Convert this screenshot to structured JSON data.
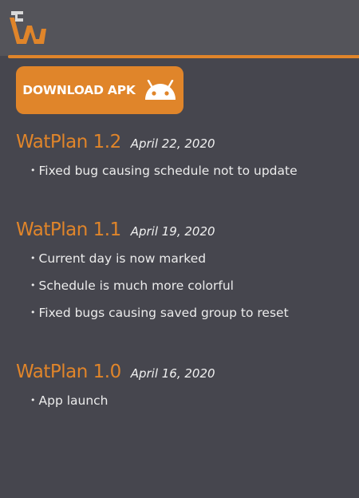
{
  "download_button": {
    "label": "DOWNLOAD APK",
    "icon": "android-icon"
  },
  "releases": [
    {
      "version": "WatPlan 1.2",
      "date": "April 22, 2020",
      "notes": [
        "Fixed bug causing schedule not to update"
      ]
    },
    {
      "version": "WatPlan 1.1",
      "date": "April 19, 2020",
      "notes": [
        "Current day is now marked",
        "Schedule is much more colorful",
        "Fixed bugs causing saved group to reset"
      ]
    },
    {
      "version": "WatPlan 1.0",
      "date": "April 16, 2020",
      "notes": [
        "App launch"
      ]
    }
  ],
  "colors": {
    "accent": "#e0852a",
    "background": "#46464e",
    "header": "#54545a",
    "text": "#ececec"
  }
}
